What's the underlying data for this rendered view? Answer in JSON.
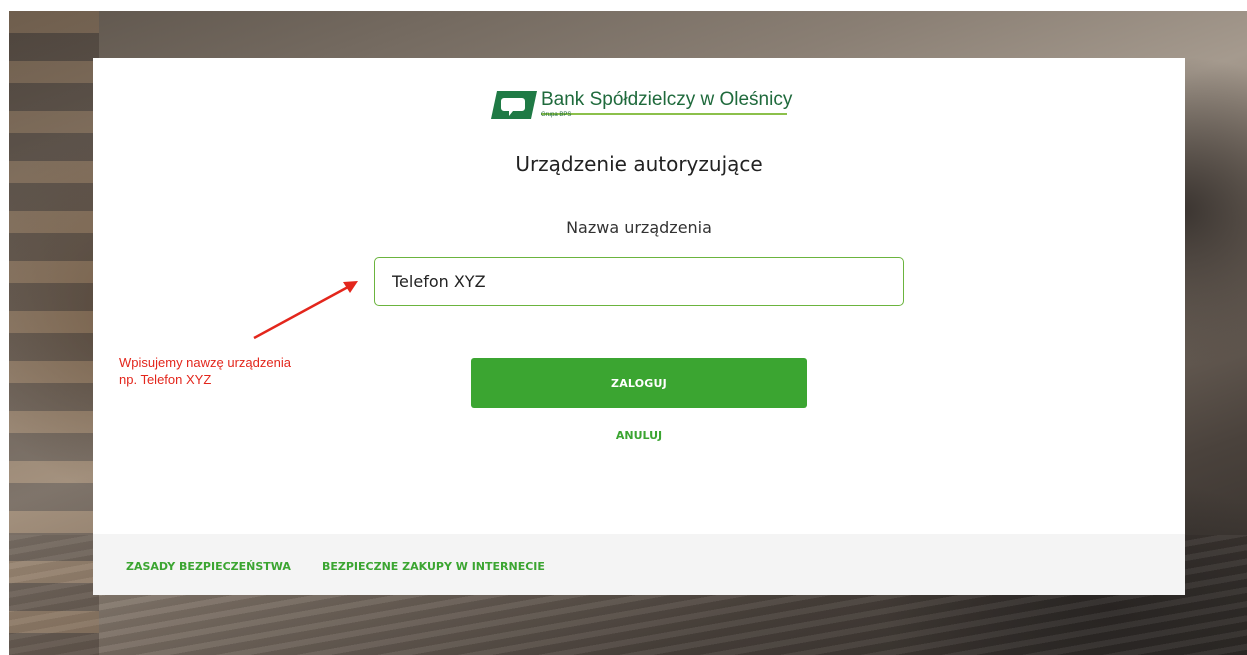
{
  "brand": {
    "name": "Bank Spółdzielczy w Oleśnicy",
    "subname": "Grupa BPS",
    "logo_icon": "bank-logo-icon",
    "primary_color": "#3ba531",
    "dark_green": "#1f6a3c"
  },
  "page": {
    "title": "Urządzenie autoryzujące"
  },
  "form": {
    "device_label": "Nazwa urządzenia",
    "device_value": "Telefon XYZ",
    "login_button": "ZALOGUJ",
    "cancel_button": "ANULUJ"
  },
  "footer": {
    "links": [
      "ZASADY BEZPIECZEŃSTWA",
      "BEZPIECZNE ZAKUPY W INTERNECIE"
    ]
  },
  "annotation": {
    "line1": "Wpisujemy nawzę urządzenia",
    "line2": "np. Telefon XYZ",
    "color": "#e3261c"
  }
}
